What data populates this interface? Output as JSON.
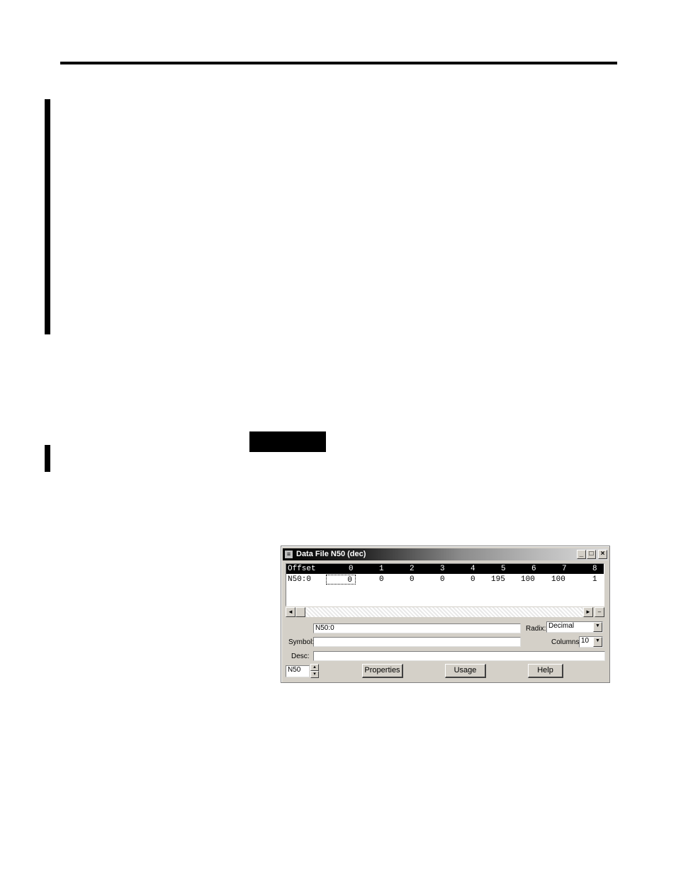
{
  "window": {
    "title": "Data File N50 (dec)",
    "controls": {
      "minimize": "_",
      "maximize": "□",
      "close": "×"
    }
  },
  "grid": {
    "header": [
      "Offset",
      "0",
      "1",
      "2",
      "3",
      "4",
      "5",
      "6",
      "7",
      "8"
    ],
    "rows": [
      {
        "offset": "N50:0",
        "values": [
          "0",
          "0",
          "0",
          "0",
          "0",
          "195",
          "100",
          "100",
          "1"
        ]
      }
    ]
  },
  "fields": {
    "address_value": "N50:0",
    "symbol_label": "Symbol:",
    "symbol_value": "",
    "desc_label": "Desc:",
    "desc_value": "",
    "radix_label": "Radix:",
    "radix_value": "Decimal",
    "columns_label": "Columns",
    "columns_value": "10",
    "file_value": "N50"
  },
  "buttons": {
    "properties": "Properties",
    "usage": "Usage",
    "help": "Help"
  },
  "icons": {
    "scroll_left": "◄",
    "scroll_right": "►",
    "minus": "–",
    "dropdown": "▼",
    "spin_up": "▴",
    "spin_down": "▾",
    "window_icon": "≡"
  }
}
